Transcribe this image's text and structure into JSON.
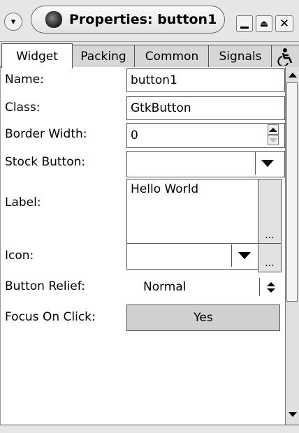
{
  "window": {
    "title": "Properties: button1",
    "minimize_icon": "minimize-icon",
    "maximize_icon": "maximize-icon",
    "close_icon": "close-icon",
    "menu_icon": "window-menu-icon"
  },
  "tabs": [
    {
      "label": "Widget",
      "active": true
    },
    {
      "label": "Packing",
      "active": false
    },
    {
      "label": "Common",
      "active": false
    },
    {
      "label": "Signals",
      "active": false
    },
    {
      "label": "",
      "icon": "accessibility-icon",
      "active": false
    }
  ],
  "properties": {
    "name": {
      "label": "Name:",
      "value": "button1"
    },
    "class": {
      "label": "Class:",
      "value": "GtkButton"
    },
    "border_width": {
      "label": "Border Width:",
      "value": "0"
    },
    "stock_button": {
      "label": "Stock Button:",
      "value": ""
    },
    "label": {
      "label": "Label:",
      "value": "Hello World",
      "edit_button": "..."
    },
    "icon": {
      "label": "Icon:",
      "value": "",
      "edit_button": "..."
    },
    "button_relief": {
      "label": "Button Relief:",
      "value": "Normal"
    },
    "focus_on_click": {
      "label": "Focus On Click:",
      "value": "Yes"
    }
  },
  "colors": {
    "chrome": "#e6e6e6",
    "toggle_button": "#d0d0d0",
    "border": "#555555"
  }
}
